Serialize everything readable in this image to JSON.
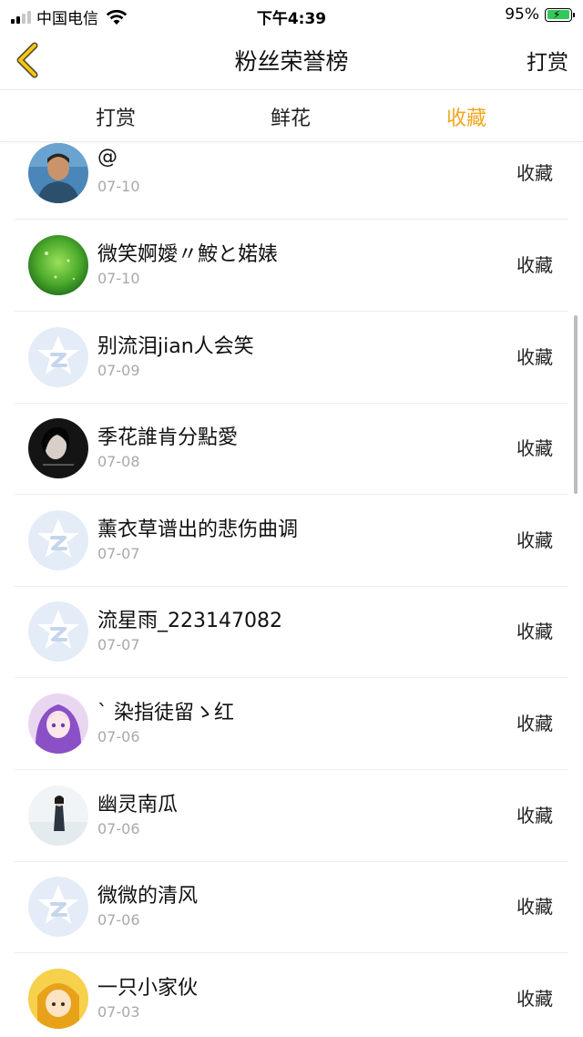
{
  "status_bar": {
    "carrier": "中国电信",
    "time": "下午4:39",
    "battery": "95%"
  },
  "nav": {
    "title": "粉丝荣誉榜",
    "action_label": "打赏"
  },
  "tabs": [
    {
      "label": "打赏",
      "active": false
    },
    {
      "label": "鲜花",
      "active": false
    },
    {
      "label": "收藏",
      "active": true
    }
  ],
  "accent_color": "#f0a820",
  "list": [
    {
      "name": "@",
      "date": "07-10",
      "action": "收藏",
      "avatar": "photo-man-avatar"
    },
    {
      "name": "微笑婀嬡〃鮟と婼婊",
      "date": "07-10",
      "action": "收藏",
      "avatar": "green-bokeh-avatar"
    },
    {
      "name": "别流泪jian人会笑",
      "date": "07-09",
      "action": "收藏",
      "avatar": "default-qq-avatar"
    },
    {
      "name": "季花誰肯分點愛",
      "date": "07-08",
      "action": "收藏",
      "avatar": "dark-portrait-avatar"
    },
    {
      "name": "薰衣草谱出的悲伤曲调",
      "date": "07-07",
      "action": "收藏",
      "avatar": "default-qq-avatar"
    },
    {
      "name": "流星雨_223147082",
      "date": "07-07",
      "action": "收藏",
      "avatar": "default-qq-avatar"
    },
    {
      "name": "ˋ 染指徒留ゝ红",
      "date": "07-06",
      "action": "收藏",
      "avatar": "anime-purple-avatar"
    },
    {
      "name": "幽灵南瓜",
      "date": "07-06",
      "action": "收藏",
      "avatar": "winter-figure-avatar"
    },
    {
      "name": "微微的清风",
      "date": "07-06",
      "action": "收藏",
      "avatar": "default-qq-avatar"
    },
    {
      "name": "一只小家伙",
      "date": "07-03",
      "action": "收藏",
      "avatar": "cartoon-yellow-avatar"
    }
  ]
}
